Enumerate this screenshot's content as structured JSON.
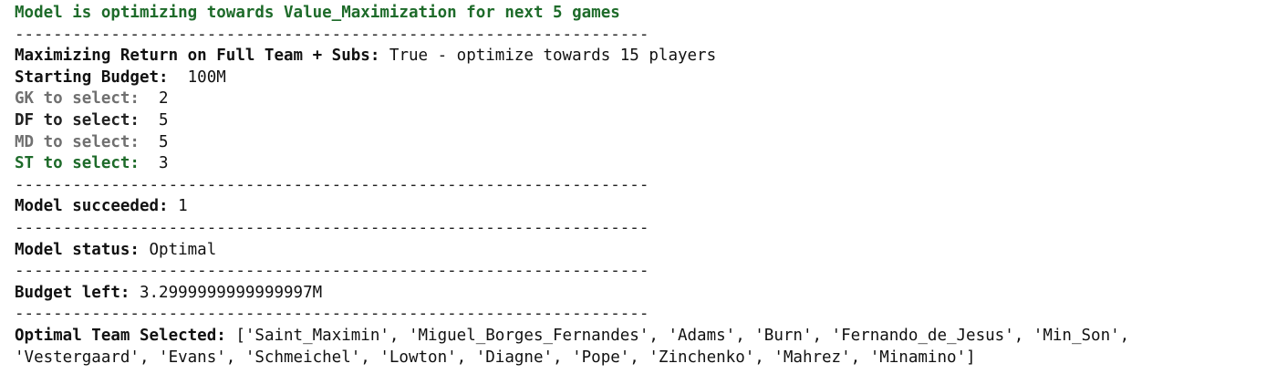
{
  "header": {
    "objective_line": "Model is optimizing towards Value_Maximization for next 5 games",
    "objective_color": "#1e6b2a"
  },
  "separator": "------------------------------------------------------------------",
  "settings": {
    "max_return_label": "Maximizing Return on Full Team + Subs:",
    "max_return_value": " True - optimize towards 15 players",
    "budget_label": "Starting Budget:",
    "budget_value": "  100M",
    "gk_label": "GK to select:",
    "gk_value": "  2",
    "df_label": "DF to select:",
    "df_value": "  5",
    "md_label": "MD to select:",
    "md_value": "  5",
    "st_label": "ST to select:",
    "st_value": "  3"
  },
  "results": {
    "succeeded_label": "Model succeeded:",
    "succeeded_value": " 1",
    "status_label": "Model status:",
    "status_value": " Optimal",
    "budget_left_label": "Budget left:",
    "budget_left_value": " 3.2999999999999997M",
    "team_label": "Optimal Team Selected:",
    "team_value_line1": " ['Saint_Maximin', 'Miguel_Borges_Fernandes', 'Adams', 'Burn', 'Fernando_de_Jesus', 'Min_Son',",
    "team_value_line2": "'Vestergaard', 'Evans', 'Schmeichel', 'Lowton', 'Diagne', 'Pope', 'Zinchenko', 'Mahrez', 'Minamino']"
  },
  "colors": {
    "green_label": "#1e6b2a",
    "grey_label": "#707070"
  }
}
